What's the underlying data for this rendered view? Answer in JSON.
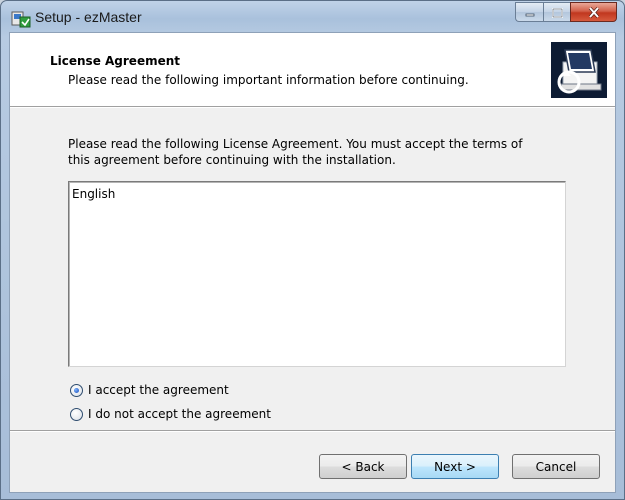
{
  "window": {
    "title": "Setup - ezMaster"
  },
  "icons": {
    "app": "setup-installer-icon",
    "minimize": "minimize-icon",
    "maximize": "maximize-icon",
    "close": "close-icon",
    "header_image": "computer-install-icon"
  },
  "header": {
    "title": "License Agreement",
    "subtitle": "Please read the following important information before continuing."
  },
  "main": {
    "intro": "Please read the following License Agreement. You must accept the terms of this agreement before continuing with the installation.",
    "license_text": "English",
    "options": [
      {
        "label": "I accept the agreement",
        "selected": true
      },
      {
        "label": "I do not accept the agreement",
        "selected": false
      }
    ]
  },
  "buttons": {
    "back": "< Back",
    "next": "Next >",
    "cancel": "Cancel"
  },
  "colors": {
    "client_bg": "#f0f0f0",
    "close_button": "#c1371f",
    "default_button_border": "#3c7fb1"
  }
}
